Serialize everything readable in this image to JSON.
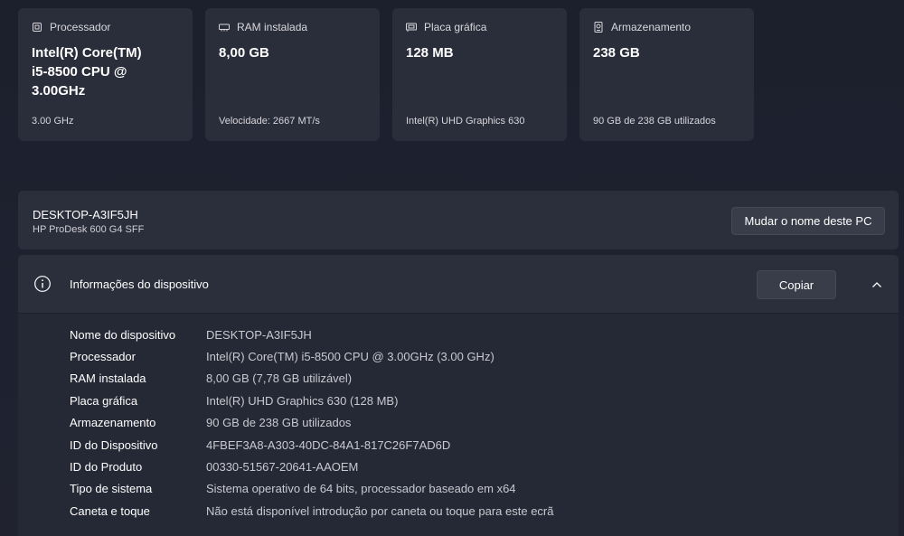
{
  "cards": [
    {
      "icon": "processor-icon",
      "title": "Processador",
      "value": [
        "Intel(R) Core(TM)",
        "i5-8500 CPU @",
        "3.00GHz"
      ],
      "sub": "3.00 GHz"
    },
    {
      "icon": "ram-icon",
      "title": "RAM instalada",
      "value": [
        "8,00 GB"
      ],
      "sub": "Velocidade: 2667 MT/s"
    },
    {
      "icon": "graphics-card-icon",
      "title": "Placa gráfica",
      "value": [
        "128 MB"
      ],
      "sub": "Intel(R) UHD Graphics 630"
    },
    {
      "icon": "storage-icon",
      "title": "Armazenamento",
      "value": [
        "238 GB"
      ],
      "sub": "90 GB de 238 GB utilizados"
    }
  ],
  "pc": {
    "name": "DESKTOP-A3IF5JH",
    "model": "HP ProDesk 600 G4 SFF",
    "rename_label": "Mudar o nome deste PC"
  },
  "device_info": {
    "title": "Informações do dispositivo",
    "copy_label": "Copiar",
    "rows": [
      {
        "label": "Nome do dispositivo",
        "value": "DESKTOP-A3IF5JH"
      },
      {
        "label": "Processador",
        "value": "Intel(R) Core(TM) i5-8500 CPU @ 3.00GHz (3.00 GHz)"
      },
      {
        "label": "RAM instalada",
        "value": "8,00 GB (7,78 GB utilizável)"
      },
      {
        "label": "Placa gráfica",
        "value": "Intel(R) UHD Graphics 630 (128 MB)"
      },
      {
        "label": "Armazenamento",
        "value": "90 GB de 238 GB utilizados"
      },
      {
        "label": "ID do Dispositivo",
        "value": "4FBEF3A8-A303-40DC-84A1-817C26F7AD6D"
      },
      {
        "label": "ID do Produto",
        "value": "00330-51567-20641-AAOEM"
      },
      {
        "label": "Tipo de sistema",
        "value": "Sistema operativo de 64 bits, processador baseado em x64"
      },
      {
        "label": "Caneta e toque",
        "value": "Não está disponível introdução por caneta ou toque para este ecrã"
      }
    ]
  }
}
